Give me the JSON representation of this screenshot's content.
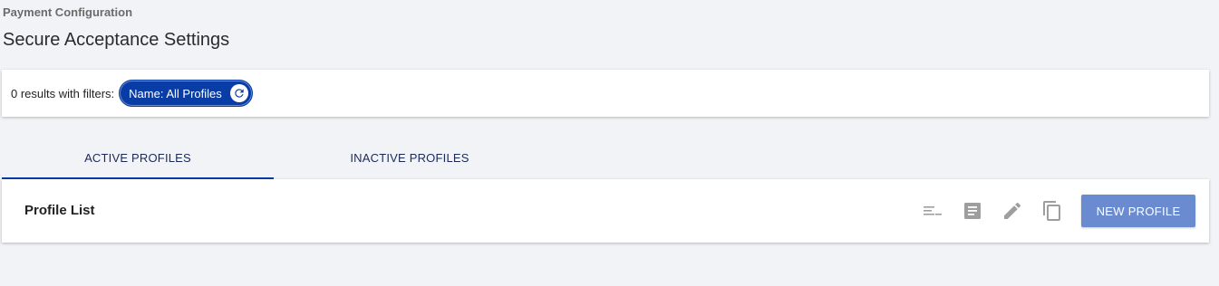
{
  "header": {
    "breadcrumb": "Payment Configuration",
    "title": "Secure Acceptance Settings"
  },
  "filters": {
    "results_text": "0 results with filters:",
    "chip_label": "Name: All Profiles",
    "chip_icon": "reset-icon"
  },
  "tabs": [
    {
      "label": "ACTIVE PROFILES",
      "active": true
    },
    {
      "label": "INACTIVE PROFILES",
      "active": false
    }
  ],
  "profile_list": {
    "title": "Profile List",
    "toolbar_icons": [
      "sort-icon",
      "document-icon",
      "edit-icon",
      "copy-icon"
    ],
    "new_button_label": "NEW PROFILE"
  },
  "colors": {
    "accent": "#0a3ca6",
    "button": "#6a8bd0",
    "icon_gray": "#9e9e9e",
    "background": "#f2f3f6"
  }
}
